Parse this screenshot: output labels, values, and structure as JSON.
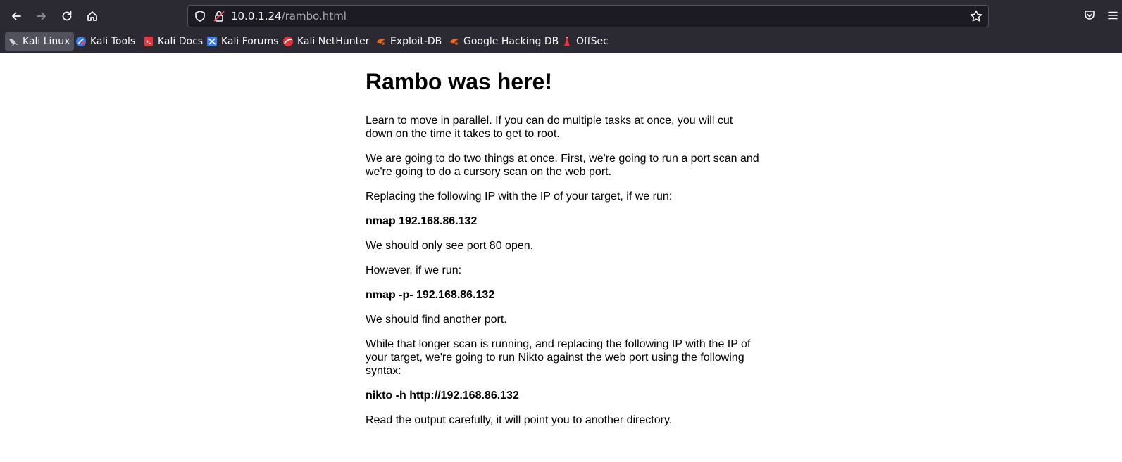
{
  "browser": {
    "url_host": "10.0.1.24",
    "url_path": "/rambo.html",
    "icons": [
      "back-icon",
      "forward-icon",
      "reload-icon",
      "home-icon",
      "shield-icon",
      "lock-icon",
      "star-icon",
      "pocket-icon",
      "menu-icon"
    ]
  },
  "bookmarks": [
    {
      "label": "Kali Linux",
      "icon": "kali-dragon-icon"
    },
    {
      "label": "Kali Tools",
      "icon": "kali-tools-icon"
    },
    {
      "label": "Kali Docs",
      "icon": "kali-docs-icon"
    },
    {
      "label": "Kali Forums",
      "icon": "kali-forums-icon"
    },
    {
      "label": "Kali NetHunter",
      "icon": "kali-nethunter-icon"
    },
    {
      "label": "Exploit-DB",
      "icon": "exploit-db-icon"
    },
    {
      "label": "Google Hacking DB",
      "icon": "ghdb-icon"
    },
    {
      "label": "OffSec",
      "icon": "offsec-icon"
    }
  ],
  "content": {
    "title": "Rambo was here!",
    "paragraphs": [
      "Learn to move in parallel. If you can do multiple tasks at once, you will cut down on the time it takes to get to root.",
      "We are going to do two things at once. First, we're going to run a port scan and we're going to do a cursory scan on the web port.",
      "Replacing the following IP with the IP of your target, if we run:",
      "nmap 192.168.86.132",
      "We should only see port 80 open.",
      "However, if we run:",
      "nmap -p- 192.168.86.132",
      "We should find another port.",
      "While that longer scan is running, and replacing the following IP with the IP of your target, we're going to run Nikto against the web port using the following syntax:",
      "nikto -h http://192.168.86.132",
      "Read the output carefully, it will point you to another directory."
    ]
  },
  "colors": {
    "chrome_bg": "#2b2a33",
    "urlbar_bg": "#1c1b22",
    "page_bg": "#ffffff"
  }
}
